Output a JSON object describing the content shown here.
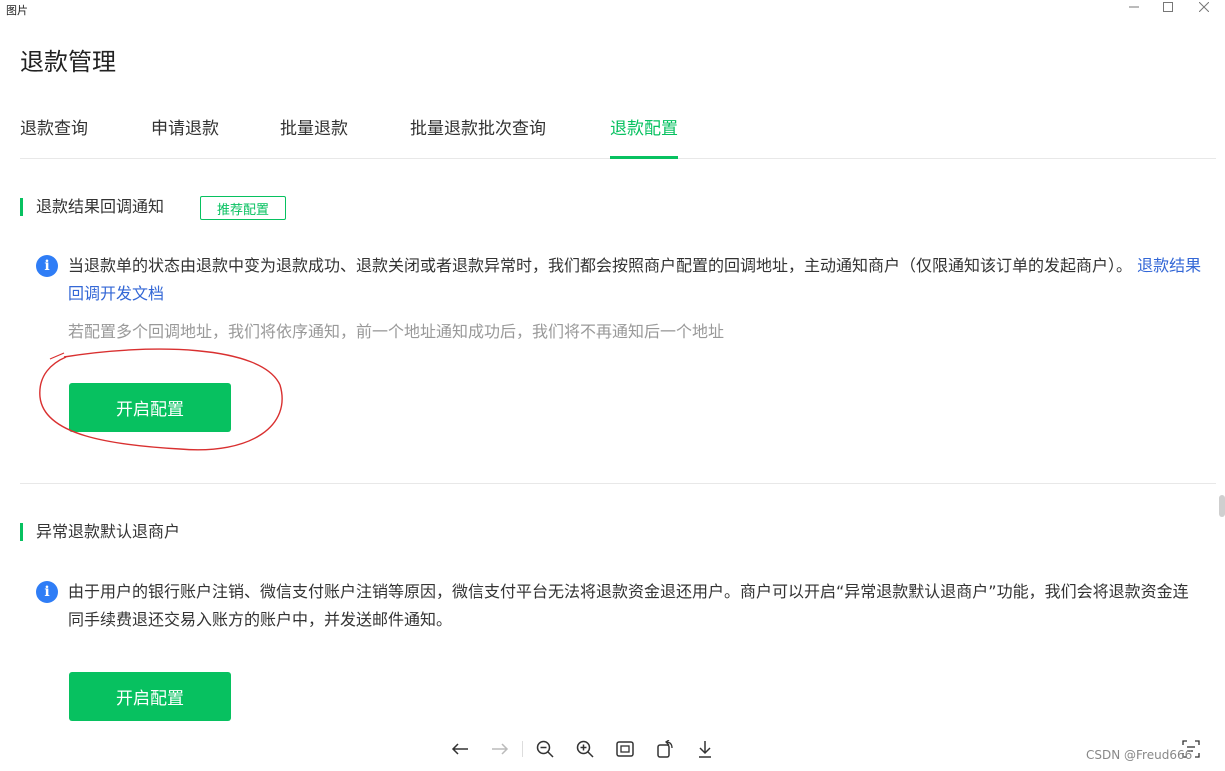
{
  "window": {
    "title": "图片",
    "minimize_icon": "minimize-icon",
    "maximize_icon": "maximize-icon",
    "close_icon": "close-icon"
  },
  "page": {
    "title": "退款管理"
  },
  "tabs": [
    {
      "label": "退款查询",
      "active": false
    },
    {
      "label": "申请退款",
      "active": false
    },
    {
      "label": "批量退款",
      "active": false
    },
    {
      "label": "批量退款批次查询",
      "active": false
    },
    {
      "label": "退款配置",
      "active": true
    }
  ],
  "sections": [
    {
      "title": "退款结果回调通知",
      "tag": "推荐配置",
      "description": "当退款单的状态由退款中变为退款成功、退款关闭或者退款异常时，我们都会按照商户配置的回调地址，主动通知商户（仅限通知该订单的发起商户）。",
      "link": "退款结果回调开发文档",
      "note": "若配置多个回调地址，我们将依序通知，前一个地址通知成功后，我们将不再通知后一个地址",
      "button": "开启配置"
    },
    {
      "title": "异常退款默认退商户",
      "description": "由于用户的银行账户注销、微信支付账户注销等原因，微信支付平台无法将退款资金退还用户。商户可以开启“异常退款默认退商户”功能，我们会将退款资金连同手续费退还交易入账方的账户中，并发送邮件通知。",
      "button": "开启配置"
    }
  ],
  "viewer_toolbar": [
    "back-arrow-icon",
    "forward-arrow-icon",
    "zoom-out-icon",
    "zoom-in-icon",
    "fit-screen-icon",
    "rotate-icon",
    "download-icon",
    "ocr-text-icon"
  ],
  "watermark": "CSDN @Freud666",
  "colors": {
    "accent": "#07c160",
    "link": "#3367d6",
    "info_icon": "#2f7df6",
    "annotation": "#d93030"
  }
}
